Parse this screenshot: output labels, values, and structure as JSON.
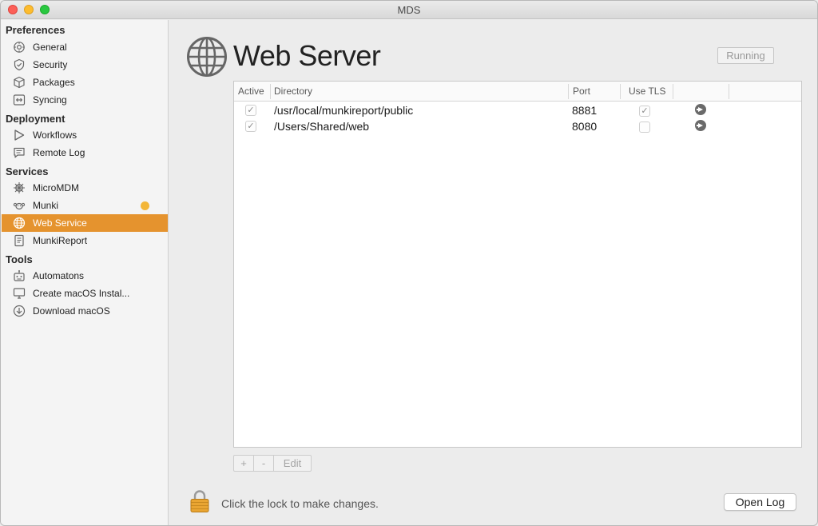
{
  "window": {
    "title": "MDS"
  },
  "sidebar": {
    "sections": [
      {
        "title": "Preferences",
        "items": [
          {
            "label": "General",
            "icon": "gear-icon"
          },
          {
            "label": "Security",
            "icon": "shield-icon"
          },
          {
            "label": "Packages",
            "icon": "package-icon"
          },
          {
            "label": "Syncing",
            "icon": "sync-icon"
          }
        ]
      },
      {
        "title": "Deployment",
        "items": [
          {
            "label": "Workflows",
            "icon": "play-icon"
          },
          {
            "label": "Remote Log",
            "icon": "speech-bubble-icon"
          }
        ]
      },
      {
        "title": "Services",
        "items": [
          {
            "label": "MicroMDM",
            "icon": "helm-icon"
          },
          {
            "label": "Munki",
            "icon": "munki-icon",
            "badge_color": "#f3b638"
          },
          {
            "label": "Web Service",
            "icon": "globe-icon",
            "selected": true
          },
          {
            "label": "MunkiReport",
            "icon": "report-icon"
          }
        ]
      },
      {
        "title": "Tools",
        "items": [
          {
            "label": "Automatons",
            "icon": "robot-icon"
          },
          {
            "label": "Create macOS Instal...",
            "icon": "monitor-icon"
          },
          {
            "label": "Download macOS",
            "icon": "download-icon"
          }
        ]
      }
    ],
    "accent": "#e5932e"
  },
  "main": {
    "title": "Web Server",
    "status_label": "Running",
    "table": {
      "headers": [
        "Active",
        "Directory",
        "Port",
        "Use TLS"
      ],
      "rows": [
        {
          "active": true,
          "directory": "/usr/local/munkireport/public",
          "port": "8881",
          "tls": true
        },
        {
          "active": true,
          "directory": "/Users/Shared/web",
          "port": "8080",
          "tls": false
        }
      ]
    },
    "controls": {
      "add": "+",
      "remove": "-",
      "edit": "Edit"
    },
    "lock_text": "Click the lock to make changes.",
    "open_log": "Open Log"
  }
}
